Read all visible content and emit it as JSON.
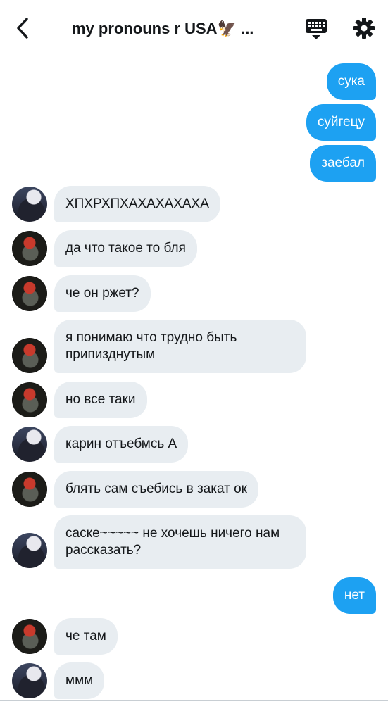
{
  "header": {
    "title": "my pronouns r USA🦅 ...",
    "back_icon": "chevron-left-icon",
    "keyboard_icon": "keyboard-icon",
    "settings_icon": "gear-icon"
  },
  "colors": {
    "outgoing_bubble": "#1da1f2",
    "incoming_bubble": "#e8edf1",
    "text_dark": "#14171a"
  },
  "messages": [
    {
      "side": "out",
      "text": "сука"
    },
    {
      "side": "out",
      "text": "суйгецу"
    },
    {
      "side": "out",
      "text": "заебал"
    },
    {
      "side": "in",
      "avatar": "sasuke",
      "text": "ХПХРХПХАХАХАХАХА"
    },
    {
      "side": "in",
      "avatar": "karin",
      "text": "да что такое то бля"
    },
    {
      "side": "in",
      "avatar": "karin",
      "text": "че он ржет?"
    },
    {
      "side": "in",
      "avatar": "karin",
      "text": "я понимаю что трудно быть припизднутым"
    },
    {
      "side": "in",
      "avatar": "karin",
      "text": "но все таки"
    },
    {
      "side": "in",
      "avatar": "sasuke",
      "text": "карин отъебмсь А"
    },
    {
      "side": "in",
      "avatar": "karin",
      "text": "блять сам съебись в закат ок"
    },
    {
      "side": "in",
      "avatar": "sasuke",
      "text": "саске~~~~~ не хочешь ничего нам рассказать?"
    },
    {
      "side": "out",
      "text": "нет"
    },
    {
      "side": "in",
      "avatar": "karin",
      "text": "че там"
    },
    {
      "side": "in",
      "avatar": "sasuke",
      "text": "ммм"
    }
  ]
}
